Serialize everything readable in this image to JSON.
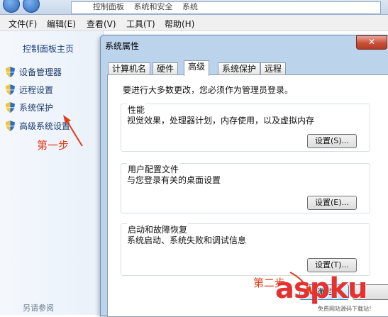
{
  "address_bar": {
    "crumbs": [
      "控制面板",
      "系统和安全",
      "系统"
    ]
  },
  "menu": {
    "items": [
      "文件(F)",
      "编辑(E)",
      "查看(V)",
      "工具(T)",
      "帮助(H)"
    ]
  },
  "left_pane": {
    "home_link": "控制面板主页",
    "items": [
      "设备管理器",
      "远程设置",
      "系统保护",
      "高级系统设置"
    ],
    "see_also": "另请参阅"
  },
  "annotations": {
    "step1": "第一步",
    "step2": "第二步",
    "color": "#e23b16"
  },
  "dialog": {
    "title": "系统属性",
    "close_glyph": "✕",
    "tabs": [
      "计算机名",
      "硬件",
      "高级",
      "系统保护",
      "远程"
    ],
    "active_tab": "高级",
    "admin_note": "要进行大多数更改，您必须作为管理员登录。",
    "groups": [
      {
        "title": "性能",
        "description": "视觉效果，处理器计划，内存使用，以及虚拟内存",
        "button": "设置(S)..."
      },
      {
        "title": "用户配置文件",
        "description": "与您登录有关的桌面设置",
        "button": "设置(E)..."
      },
      {
        "title": "启动和故障恢复",
        "description": "系统启动、系统失败和调试信息",
        "button": "设置(T)..."
      }
    ],
    "ok_button": "确定"
  },
  "watermark": {
    "text": "aspku",
    "subtext": "免费网站源码下载站！"
  }
}
